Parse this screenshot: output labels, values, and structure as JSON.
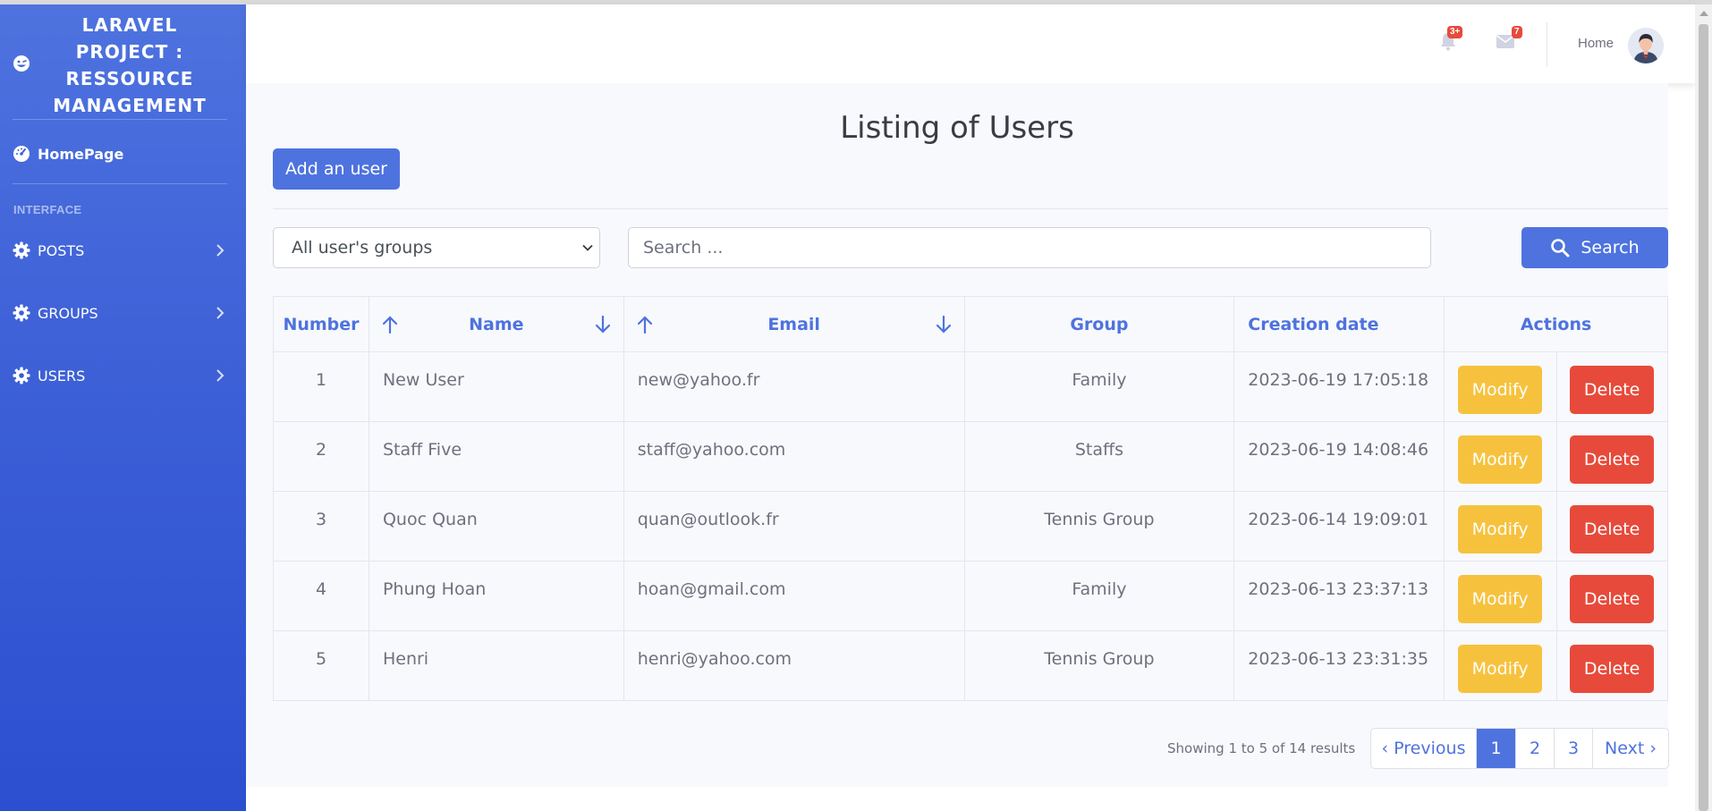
{
  "sidebar": {
    "brand": "LARAVEL PROJECT : RESSOURCE MANAGEMENT",
    "home_label": "HomePage",
    "section_heading": "INTERFACE",
    "items": [
      {
        "label": "POSTS"
      },
      {
        "label": "GROUPS"
      },
      {
        "label": "USERS"
      }
    ]
  },
  "topbar": {
    "alerts_badge": "3+",
    "messages_badge": "7",
    "user_label": "Home"
  },
  "main": {
    "title": "Listing of Users",
    "add_button": "Add an user",
    "group_select": "All user's groups",
    "search_placeholder": "Search ...",
    "search_button": "Search"
  },
  "table": {
    "headers": {
      "number": "Number",
      "name": "Name",
      "email": "Email",
      "group": "Group",
      "date": "Creation date",
      "actions": "Actions"
    },
    "rows": [
      {
        "number": "1",
        "name": "New User",
        "email": "new@yahoo.fr",
        "group": "Family",
        "date": "2023-06-19 17:05:18"
      },
      {
        "number": "2",
        "name": "Staff Five",
        "email": "staff@yahoo.com",
        "group": "Staffs",
        "date": "2023-06-19 14:08:46"
      },
      {
        "number": "3",
        "name": "Quoc Quan",
        "email": "quan@outlook.fr",
        "group": "Tennis Group",
        "date": "2023-06-14 19:09:01"
      },
      {
        "number": "4",
        "name": "Phung Hoan",
        "email": "hoan@gmail.com",
        "group": "Family",
        "date": "2023-06-13 23:37:13"
      },
      {
        "number": "5",
        "name": "Henri",
        "email": "henri@yahoo.com",
        "group": "Tennis Group",
        "date": "2023-06-13 23:31:35"
      }
    ],
    "modify_label": "Modify",
    "delete_label": "Delete"
  },
  "pagination": {
    "summary": "Showing 1 to 5 of 14 results",
    "previous": "‹ Previous",
    "pages": [
      "1",
      "2",
      "3"
    ],
    "next": "Next ›",
    "current": "1"
  },
  "colors": {
    "primary": "#4e73df",
    "warning": "#f6c23e",
    "danger": "#e74a3b"
  }
}
